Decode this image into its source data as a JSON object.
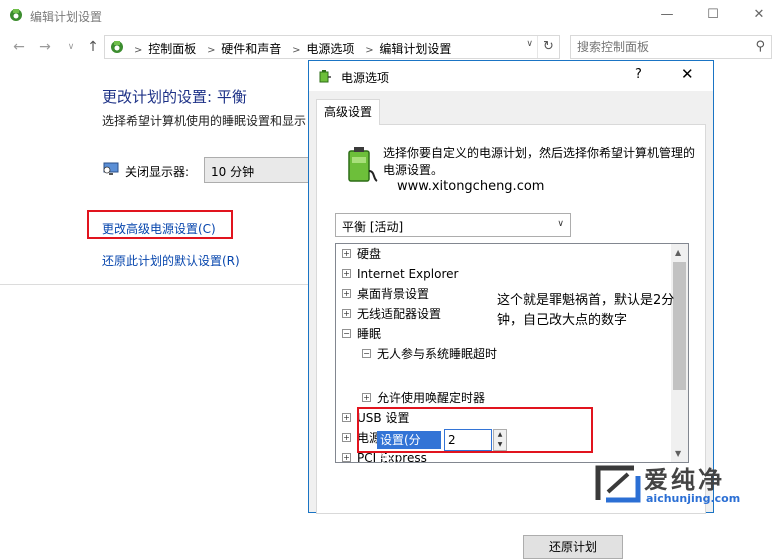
{
  "window": {
    "title": "编辑计划设置",
    "controls": {
      "minimize": "—",
      "maximize": "☐",
      "close": "✕"
    }
  },
  "nav": {
    "back": "←",
    "forward": "→",
    "recent": "∨",
    "up": "↑",
    "breadcrumbs": [
      "控制面板",
      "硬件和声音",
      "电源选项",
      "编辑计划设置"
    ],
    "search_placeholder": "搜索控制面板"
  },
  "main": {
    "title": "更改计划的设置: 平衡",
    "subtitle": "选择希望计算机使用的睡眠设置和显示",
    "display_off_label": "关闭显示器:",
    "display_off_value": "10 分钟",
    "advanced_link": "更改高级电源设置(C)",
    "restore_link": "还原此计划的默认设置(R)"
  },
  "dialog": {
    "title": "电源选项",
    "help": "?",
    "close": "✕",
    "tab": "高级设置",
    "description": "选择你要自定义的电源计划，然后选择你希望计算机管理的电源设置。",
    "url": "www.xitongcheng.com",
    "plan_selected": "平衡 [活动]",
    "tree": [
      {
        "label": "硬盘",
        "sign": "+"
      },
      {
        "label": "Internet Explorer",
        "sign": "+"
      },
      {
        "label": "桌面背景设置",
        "sign": "+"
      },
      {
        "label": "无线适配器设置",
        "sign": "+"
      },
      {
        "label": "睡眠",
        "sign": "−"
      },
      {
        "label": "无人参与系统睡眠超时",
        "sign": "−"
      },
      {
        "label": "允许使用唤醒定时器",
        "sign": "+"
      },
      {
        "label": "USB 设置",
        "sign": "+"
      },
      {
        "label": "电源按钮和盖子",
        "sign": "+"
      },
      {
        "label": "PCI Express",
        "sign": "+"
      }
    ],
    "setting_label": "设置(分钟):",
    "setting_value": "2",
    "annotation": "这个就是罪魁祸首，默认是2分钟，自己改大点的数字",
    "restore_button": "还原计划"
  },
  "logo": {
    "cn": "爱纯净",
    "en": "aichunjing.com"
  },
  "colors": {
    "link": "#0645ad",
    "title": "#1e3287",
    "highlight": "#e1141e",
    "selection": "#3374d6"
  }
}
